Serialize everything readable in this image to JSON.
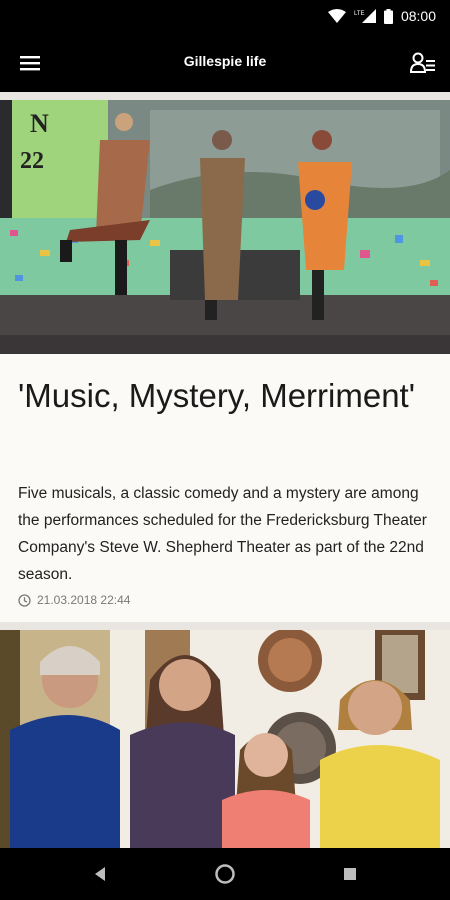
{
  "status_bar": {
    "time": "08:00",
    "icons": [
      "wifi-icon",
      "signal-icon",
      "battery-icon"
    ],
    "network_label": "LTE"
  },
  "app_bar": {
    "title": "Gillespie life",
    "left_icon": "menu-icon",
    "right_icon": "profile-list-icon"
  },
  "articles": [
    {
      "title": "'Music, Mystery, Merriment'",
      "summary": "Five musicals, a classic comedy and a mystery are among the performances scheduled for the Fredericksburg Theater Company's Steve W. Shepherd Theater as part of the 22nd season.",
      "date": "21.03.2018 22:44",
      "image_text": "N 22",
      "meta_icon": "clock-icon"
    },
    {
      "title": "",
      "image_subject": "family-photo"
    }
  ],
  "nav_bar": {
    "buttons": [
      "back-icon",
      "home-icon",
      "recents-icon"
    ]
  },
  "colors": {
    "bar_background": "#000000",
    "card_background": "#fcfaf7",
    "divider": "#e9e6e1",
    "text_primary": "#1a1a1a",
    "text_meta": "#7a7a7a"
  }
}
